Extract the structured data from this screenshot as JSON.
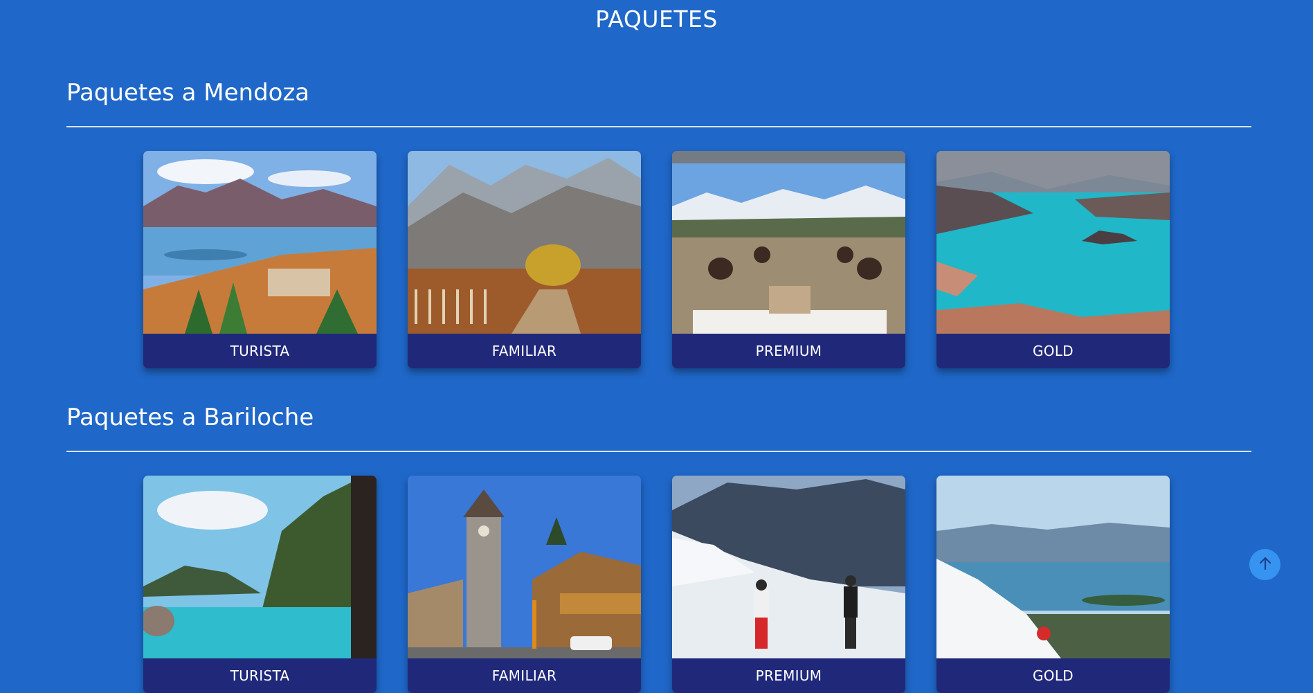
{
  "page": {
    "title": "PAQUETES"
  },
  "sections": [
    {
      "title": "Paquetes a Mendoza",
      "cards": [
        {
          "label": "TURISTA",
          "image": "lake-mountain-village-photo"
        },
        {
          "label": "FAMILIAR",
          "image": "vineyard-road-mountains-photo"
        },
        {
          "label": "PREMIUM",
          "image": "outdoor-dining-table-andes-photo"
        },
        {
          "label": "GOLD",
          "image": "turquoise-reservoir-cliffs-photo"
        }
      ]
    },
    {
      "title": "Paquetes a Bariloche",
      "cards": [
        {
          "label": "TURISTA",
          "image": "turquoise-lake-forest-cliff-photo"
        },
        {
          "label": "FAMILIAR",
          "image": "stone-clock-tower-civic-center-photo"
        },
        {
          "label": "PREMIUM",
          "image": "skiers-snowy-slope-photo"
        },
        {
          "label": "GOLD",
          "image": "skier-powder-lake-view-photo"
        }
      ]
    }
  ],
  "scroll_top": {
    "icon": "arrow-up-icon"
  },
  "colors": {
    "background": "#1f67c8",
    "label_bar": "#20287a",
    "scroll_button": "#3793f0"
  }
}
